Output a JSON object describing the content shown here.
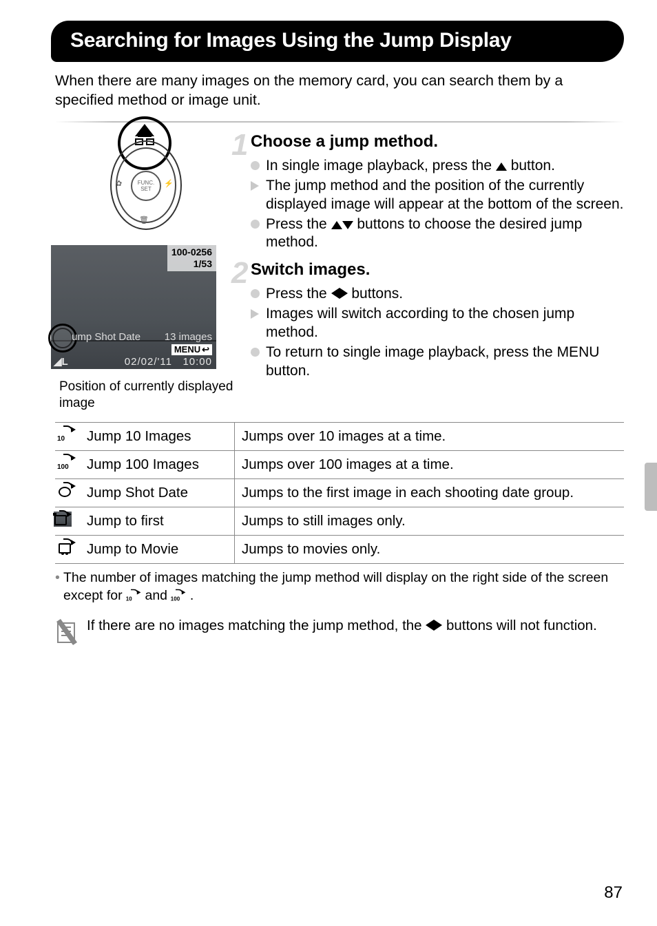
{
  "title": "Searching for Images Using the Jump Display",
  "intro": "When there are many images on the memory card, you can search them by a specified method or image unit.",
  "illustration1": {
    "center_label": "FUNC.\nSET"
  },
  "illustration2": {
    "top_right_line1": "100-0256",
    "top_right_line2": "1/53",
    "mode_label": "ump Shot Date",
    "count_label": "13 images",
    "menu_label": "MENU",
    "date_label": "02/02/'11",
    "time_label": "10:00",
    "bl_label": "L"
  },
  "caption_left": "Position of currently displayed image",
  "steps": [
    {
      "num": "1",
      "title": "Choose a jump method.",
      "items": [
        {
          "kind": "dot",
          "pre": "In single image playback, press the ",
          "glyph": "up",
          "post": " button."
        },
        {
          "kind": "tri",
          "pre": "The jump method and the position of the currently displayed image will appear at the bottom of the screen.",
          "glyph": "",
          "post": ""
        },
        {
          "kind": "dot",
          "pre": "Press the ",
          "glyph": "updown",
          "post": " buttons to choose the desired jump method."
        }
      ]
    },
    {
      "num": "2",
      "title": "Switch images.",
      "items": [
        {
          "kind": "dot",
          "pre": "Press the ",
          "glyph": "leftright",
          "post": " buttons."
        },
        {
          "kind": "tri",
          "pre": "Images will switch according to the chosen jump method.",
          "glyph": "",
          "post": ""
        },
        {
          "kind": "dot",
          "pre": "To return to single image playback, press the ",
          "glyph": "menu",
          "post": " button."
        }
      ]
    }
  ],
  "table": [
    {
      "icon": "n10",
      "sub": "10",
      "name": "Jump 10 Images",
      "desc": "Jumps over 10 images at a time."
    },
    {
      "icon": "n100",
      "sub": "100",
      "name": "Jump 100 Images",
      "desc": "Jumps over 100 images at a time."
    },
    {
      "icon": "clock",
      "sub": "",
      "name": "Jump Shot Date",
      "desc": "Jumps to the first image in each shooting date group."
    },
    {
      "icon": "cam",
      "sub": "",
      "name": "Jump to first",
      "desc": "Jumps to still images only."
    },
    {
      "icon": "movie",
      "sub": "",
      "name": "Jump to Movie",
      "desc": "Jumps to movies only."
    }
  ],
  "footnote": {
    "pre": "The number of images matching the jump method will display on the right side of the screen except for ",
    "mid": " and ",
    "post": "."
  },
  "note": {
    "pre": "If there are no images matching the jump method, the ",
    "post": " buttons will not function."
  },
  "page_number": "87"
}
